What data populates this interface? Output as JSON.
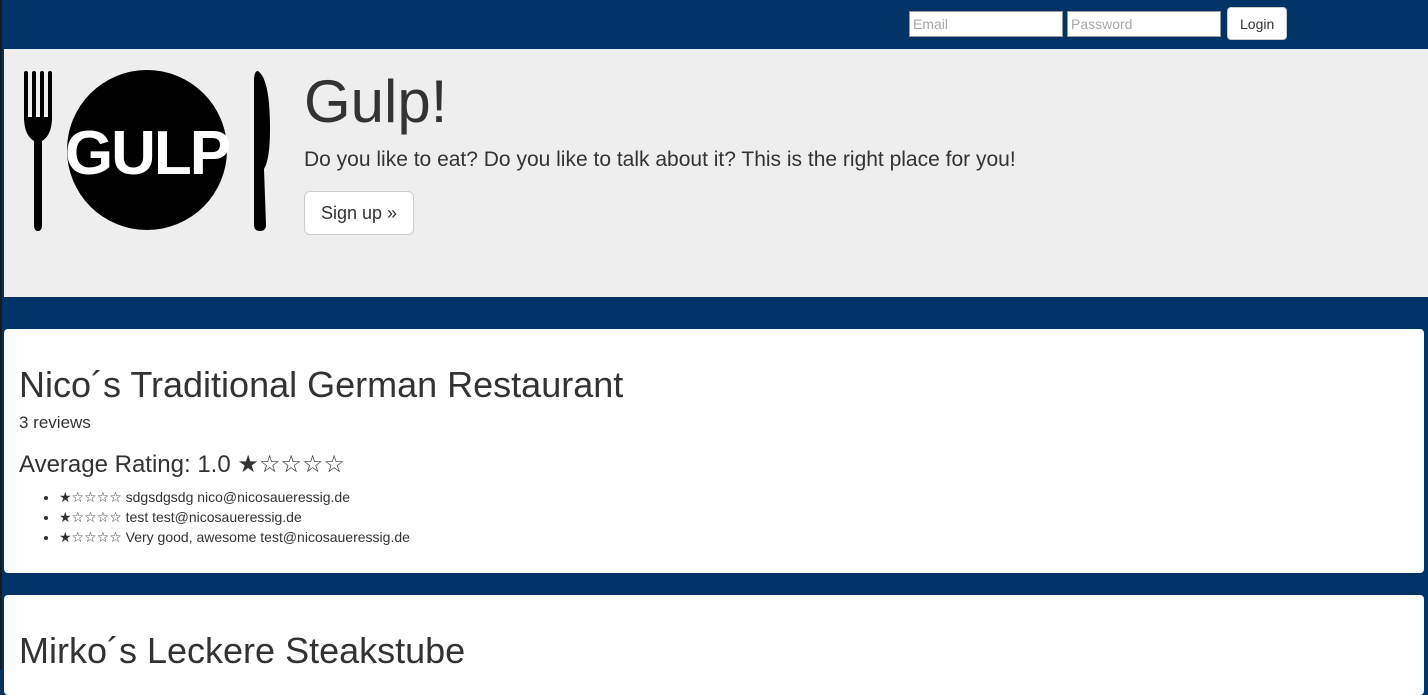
{
  "navbar": {
    "email_placeholder": "Email",
    "password_placeholder": "Password",
    "login_label": "Login"
  },
  "jumbotron": {
    "logo_text": "GULP",
    "title": "Gulp!",
    "text": "Do you like to eat? Do you like to talk about it? This is the right place for you!",
    "signup_label": "Sign up »"
  },
  "restaurants": [
    {
      "name": "Nico´s Traditional German Restaurant",
      "review_count": "3 reviews",
      "average_rating": "Average Rating: 1.0 ★☆☆☆☆",
      "reviews": [
        "★☆☆☆☆ sdgsdgsdg nico@nicosaueressig.de",
        "★☆☆☆☆ test test@nicosaueressig.de",
        "★☆☆☆☆ Very good, awesome test@nicosaueressig.de"
      ]
    },
    {
      "name": "Mirko´s Leckere Steakstube"
    }
  ],
  "colors": {
    "navbar_bg": "#003366",
    "jumbotron_bg": "#eeeeee",
    "panel_bg": "#ffffff",
    "text": "#333333"
  }
}
